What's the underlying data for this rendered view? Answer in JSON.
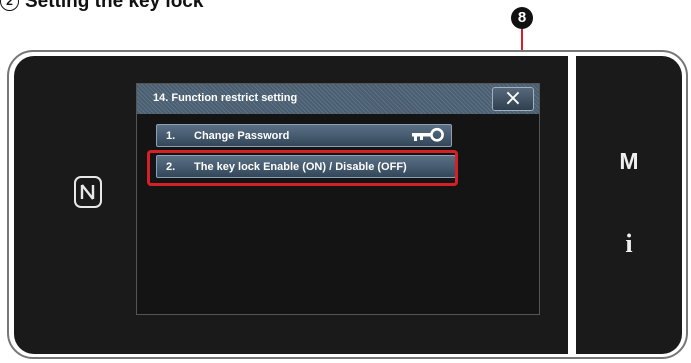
{
  "heading": {
    "number": "2",
    "text": "Setting the key lock"
  },
  "callout": {
    "label": "8"
  },
  "dialog": {
    "title": "14.  Function restrict setting",
    "close_label": "×",
    "items": [
      {
        "number": "1.",
        "label": "Change Password",
        "icon": "key-icon"
      },
      {
        "number": "2.",
        "label": "The key lock Enable (ON) / Disable (OFF)"
      }
    ]
  },
  "side_panel": {
    "m_label": "M",
    "i_label": "i"
  },
  "icons": {
    "nfc": "nfc-icon",
    "close": "close-icon",
    "key": "key-icon"
  },
  "colors": {
    "highlight": "#d42127",
    "panel": "#1a1a1a",
    "titlebar": "#5c7184"
  }
}
